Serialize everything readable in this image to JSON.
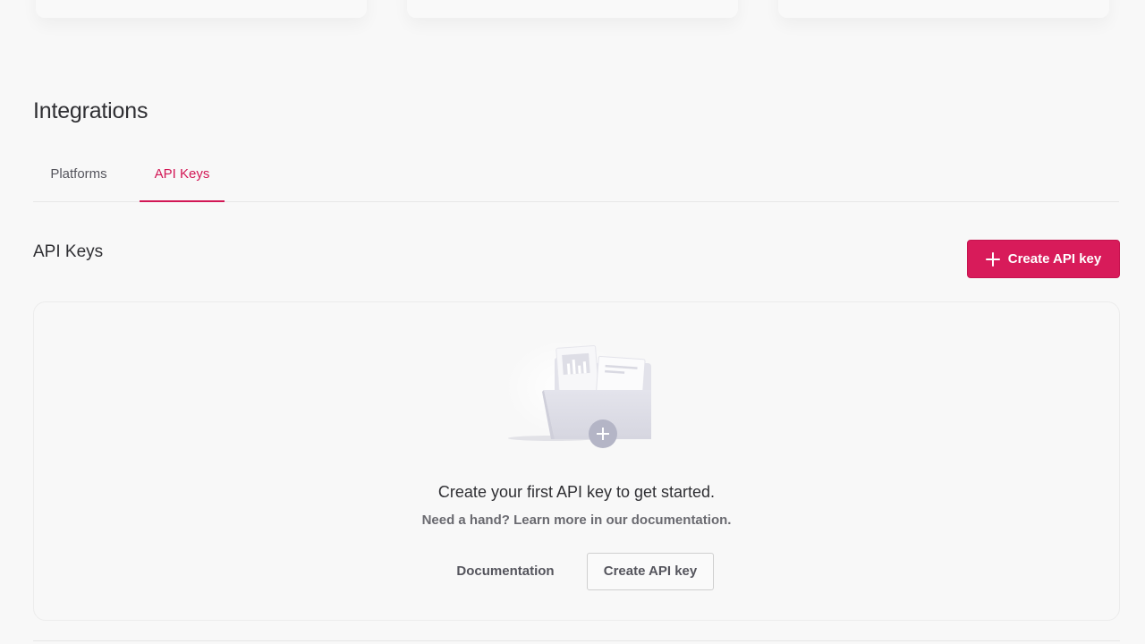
{
  "section": {
    "title": "Integrations"
  },
  "tabs": [
    {
      "label": "Platforms",
      "active": false
    },
    {
      "label": "API Keys",
      "active": true
    }
  ],
  "api_keys": {
    "title": "API Keys",
    "create_button_label": "Create API key",
    "create_button_icon": "plus-icon"
  },
  "empty_state": {
    "illustration_icon": "folder-with-documents-icon",
    "heading": "Create your first API key to get started.",
    "subtext": "Need a hand? Learn more in our documentation.",
    "documentation_label": "Documentation",
    "create_label": "Create API key"
  },
  "colors": {
    "accent": "#d81b5a",
    "active_tab": "#d21755",
    "background": "#f8f8f8"
  }
}
